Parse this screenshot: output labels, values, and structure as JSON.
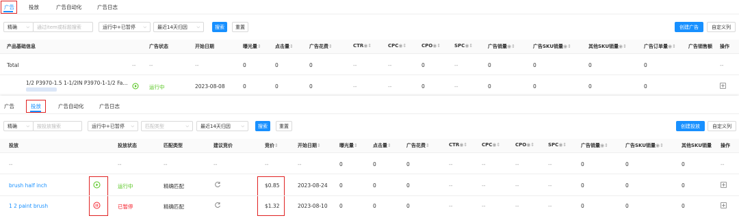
{
  "top": {
    "tabs": [
      "广告",
      "投放",
      "广告自动化",
      "广告日志"
    ],
    "filter": {
      "match_label": "精确",
      "search_placeholder": "通过item或标题搜索",
      "status": "运行中+已暂停",
      "range": "最近14天归因",
      "search_btn": "搜索",
      "reset_btn": "重置",
      "create_btn": "创建广告",
      "custom_btn": "自定义列"
    },
    "headers": [
      "产品基础信息",
      "广告状态",
      "开始日期",
      "曝光量",
      "点击量",
      "广告花费",
      "CTR",
      "CPC",
      "CPO",
      "SPC",
      "广告销量",
      "广告SKU销量",
      "其他SKU销量",
      "广告订单量",
      "广告销售额",
      "操作"
    ],
    "total_row": {
      "label": "Total",
      "status": "--",
      "status2": "--",
      "date": "--",
      "impressions": "0",
      "clicks": "0",
      "spend": "0",
      "ctr": "--",
      "cpc": "--",
      "cpo": "0",
      "spc": "--",
      "sales": "0",
      "sku_sales": "0",
      "other_sku": "0",
      "orders": "0",
      "action": "--"
    },
    "product_row": {
      "title": "1/2 P3970-1.5 1-1/2IN P3970-1-1/2 Fa...",
      "status": "运行中",
      "date": "2023-08-08",
      "impressions": "0",
      "clicks": "0",
      "spend": "0",
      "ctr": "--",
      "cpc": "--",
      "cpo": "0",
      "spc": "--",
      "sales": "0",
      "sku_sales": "0",
      "other_sku": "0",
      "orders": "0",
      "expand": "+"
    }
  },
  "bottom": {
    "tabs": [
      "广告",
      "投放",
      "广告自动化",
      "广告日志"
    ],
    "filter": {
      "match_label": "精确",
      "search_placeholder": "按投放搜索",
      "status": "运行中+已暂停",
      "match_type_placeholder": "匹配类型",
      "range": "最近14天归因",
      "search_btn": "搜索",
      "reset_btn": "重置",
      "create_btn": "创建投放",
      "custom_btn": "自定义列"
    },
    "headers": [
      "投放",
      "投放状态",
      "匹配类型",
      "建议竞价",
      "竞价",
      "开始日期",
      "曝光量",
      "点击量",
      "广告花费",
      "CTR",
      "CPC",
      "CPO",
      "SPC",
      "广告销量",
      "广告SKU销量",
      "其他SKU销量",
      "操作"
    ],
    "total_row": {
      "label": "--",
      "status": "--",
      "match": "--",
      "suggest": "--",
      "bid": "--",
      "date": "--",
      "impressions": "0",
      "clicks": "0",
      "spend": "0",
      "ctr": "--",
      "cpc": "--",
      "cpo": "--",
      "spc": "--",
      "sales": "0",
      "sku_sales": "0",
      "other_sku": "0",
      "action": "--"
    },
    "rows": [
      {
        "name": "brush half inch",
        "status": "运行中",
        "match": "精确匹配",
        "bid": "$0.85",
        "date": "2023-08-24",
        "impressions": "0",
        "clicks": "0",
        "spend": "0",
        "ctr": "--",
        "cpc": "--",
        "cpo": "--",
        "spc": "--",
        "sales": "0",
        "sku_sales": "0",
        "other_sku": "0",
        "expand": "+"
      },
      {
        "name": "1 2 paint brush",
        "status": "已暂停",
        "match": "精确匹配",
        "bid": "$1.32",
        "date": "2023-08-10",
        "impressions": "0",
        "clicks": "0",
        "spend": "0",
        "ctr": "--",
        "cpc": "--",
        "cpo": "--",
        "spc": "--",
        "sales": "0",
        "sku_sales": "0",
        "other_sku": "0",
        "expand": "+"
      }
    ]
  },
  "colors": {
    "accent": "#1890ff",
    "running": "#52c41a",
    "paused": "#f5222d",
    "highlight": "#e02020"
  }
}
